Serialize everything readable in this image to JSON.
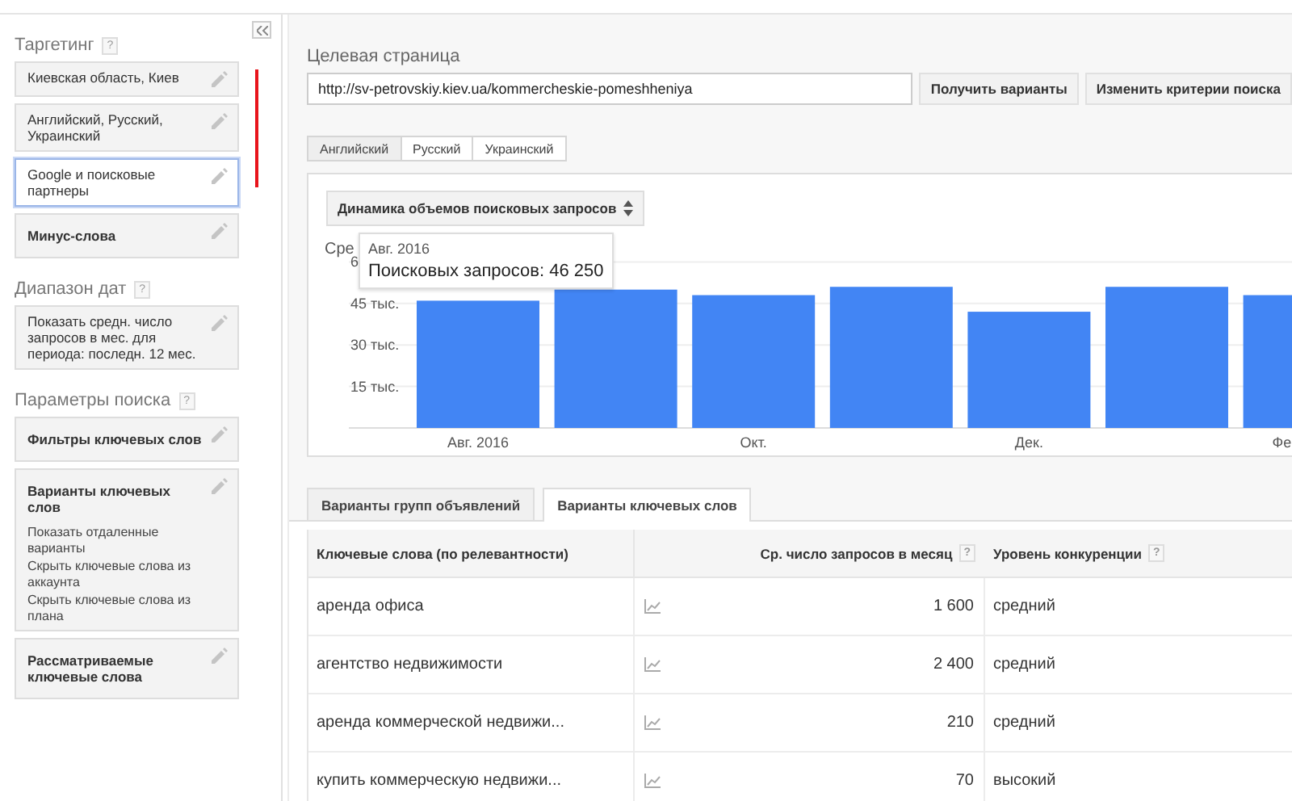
{
  "sidebar": {
    "sections": [
      {
        "title": "Таргетинг",
        "help": "?",
        "cards": [
          {
            "text": "Киевская область, Киев",
            "bold": false,
            "selected": false
          },
          {
            "text": "Английский, Русский, Украинский",
            "bold": false,
            "selected": false
          },
          {
            "text": "Google и поисковые партнеры",
            "bold": false,
            "selected": true
          },
          {
            "text": "Минус-слова",
            "bold": true,
            "selected": false
          }
        ]
      },
      {
        "title": "Диапазон дат",
        "help": "?",
        "cards": [
          {
            "text": "Показать средн. число запросов в мес. для периода: последн. 12 мес.",
            "bold": false,
            "selected": false
          }
        ]
      },
      {
        "title": "Параметры поиска",
        "help": "?",
        "cards": [
          {
            "text": "Фильтры ключевых слов",
            "bold": true,
            "selected": false
          },
          {
            "text": "Варианты ключевых слов",
            "bold": true,
            "selected": false,
            "options": [
              "Показать отдаленные варианты",
              "Скрыть ключевые слова из аккаунта",
              "Скрыть ключевые слова из плана"
            ]
          },
          {
            "text": "Рассматриваемые ключевые слова",
            "bold": true,
            "selected": false
          }
        ]
      }
    ]
  },
  "landing_page": {
    "label": "Целевая страница",
    "value": "http://sv-petrovskiy.kiev.ua/kommercheskie-pomeshheniya",
    "buttons": [
      "Получить варианты",
      "Изменить критерии поиска"
    ]
  },
  "language_tabs": [
    {
      "label": "Английский",
      "selected": true
    },
    {
      "label": "Русский",
      "selected": false
    },
    {
      "label": "Украинский",
      "selected": false
    }
  ],
  "chart_panel": {
    "dropdown": "Динамика объемов поисковых запросов",
    "tooltip": {
      "title": "Авг. 2016",
      "text": "Поисковых запросов: 46 250"
    },
    "chart_data": {
      "type": "bar",
      "ylabel": "Сре",
      "categories": [
        "Авг. 2016",
        null,
        "Окт.",
        null,
        "Дек.",
        null,
        "Фе"
      ],
      "series": [
        {
          "color": "#4285f4",
          "values": [
            46,
            50,
            48,
            51,
            42,
            51,
            48
          ]
        }
      ],
      "ylim": [
        0,
        60
      ],
      "grid": true,
      "yticks": [
        {
          "value": 15,
          "label": "15 тыс."
        },
        {
          "value": 30,
          "label": "30 тыс."
        },
        {
          "value": 45,
          "label": "45 тыс."
        }
      ]
    },
    "covered_tick_label": "6"
  },
  "result_tabs": [
    {
      "label": "Варианты групп объявлений",
      "selected": false
    },
    {
      "label": "Варианты ключевых слов",
      "selected": true
    }
  ],
  "table": {
    "columns": [
      {
        "label": "Ключевые слова (по релевантности)"
      },
      {
        "label": "Ср. число запросов в месяц",
        "help": "?"
      },
      {
        "label": "Уровень конкуренции",
        "help": "?"
      }
    ],
    "rows": [
      {
        "keyword": "аренда офиса",
        "searches": "1 600",
        "competition": "средний"
      },
      {
        "keyword": "агентство недвижимости",
        "searches": "2 400",
        "competition": "средний"
      },
      {
        "keyword": "аренда коммерческой недвижи...",
        "searches": "210",
        "competition": "средний"
      },
      {
        "keyword": "купить коммерческую недвижи...",
        "searches": "70",
        "competition": "высокий"
      }
    ]
  }
}
